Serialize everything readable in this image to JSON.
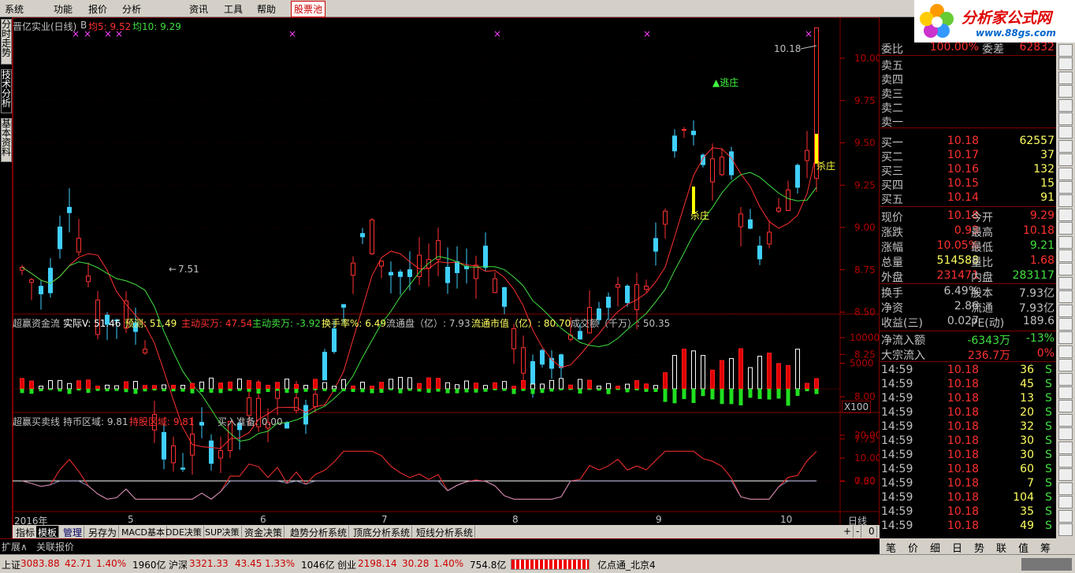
{
  "menu": [
    "系统",
    "功能",
    "报价",
    "分析",
    "资讯",
    "工具",
    "帮助"
  ],
  "menu_hot": "股票池",
  "logo": {
    "title": "分析家公式网",
    "url": "www.88gs.com"
  },
  "left_tabs": [
    "分时走势",
    "技术分析",
    "基本资料"
  ],
  "chart_header": {
    "name": "晋亿实业(日线)",
    "flag": "B",
    "ma5_label": "均5: 9.52",
    "ma10_label": "均10: 9.29"
  },
  "price_axis": [
    "10.00",
    "9.75",
    "9.50",
    "9.25",
    "9.00",
    "8.75",
    "8.50",
    "8.25",
    "8.00",
    "7.75",
    "7.50"
  ],
  "annotations": {
    "high": "10.18",
    "low": "7.51",
    "escape": "逃庄",
    "kill1": "杀庄",
    "kill2": "杀庄"
  },
  "fund_header": {
    "name": "超赢资金流",
    "actual": "实际V: 51.46",
    "predict": "预测: 51.49",
    "buy": "主动买万: 47.54",
    "sell": "主动卖万: -3.92",
    "turnover": "换手率%: 6.49",
    "float": "流通盘（亿）: 7.93",
    "floatval": "流通市值（亿）: 80.70",
    "amount": "成交额（千万）: 50.35"
  },
  "fund_axis": [
    "10000",
    "5000"
  ],
  "fund_unit": "X100",
  "buysell_header": {
    "name": "超赢买卖线",
    "hold_market": "持币区域: 9.81",
    "hold_stock": "持股区域: 9.81",
    "ready": "买入准备: 0.00"
  },
  "bs_axis": [
    "20.00",
    "10.00",
    "0.00"
  ],
  "date_axis": {
    "year": "2016年",
    "months": [
      "5",
      "6",
      "7",
      "8",
      "9",
      "10"
    ],
    "period": "日线"
  },
  "bottom_tabs": [
    "指标",
    "模板",
    "管理",
    "另存为",
    "MACD基本",
    "DDE决策",
    "SUP决策",
    "资金决策",
    "趋势分析系统",
    "顶底分析系统",
    "短线分析系统"
  ],
  "bottom_ctrl": [
    "+",
    "-",
    "0"
  ],
  "bottom_left": [
    "扩展∧",
    "关联报价"
  ],
  "quote": {
    "weibi": "委比",
    "weibi_v": "100.00%",
    "weicha": "委差",
    "weicha_v": "62832",
    "sells": [
      "卖五",
      "卖四",
      "卖三",
      "卖二",
      "卖一"
    ],
    "buys": [
      [
        "买一",
        "10.18",
        "62557"
      ],
      [
        "买二",
        "10.17",
        "37"
      ],
      [
        "买三",
        "10.16",
        "132"
      ],
      [
        "买四",
        "10.15",
        "15"
      ],
      [
        "买五",
        "10.14",
        "91"
      ]
    ],
    "rows": [
      [
        "现价",
        "10.18",
        "今开",
        "9.29"
      ],
      [
        "涨跌",
        "0.93",
        "最高",
        "10.18"
      ],
      [
        "涨幅",
        "10.05%",
        "最低",
        "9.21"
      ],
      [
        "总量",
        "514588",
        "量比",
        "1.68"
      ],
      [
        "外盘",
        "231471",
        "内盘",
        "283117"
      ]
    ],
    "rows2": [
      [
        "换手",
        "6.49%",
        "股本",
        "7.93亿"
      ],
      [
        "净资",
        "2.86",
        "流通",
        "7.93亿"
      ],
      [
        "收益(三)",
        "0.027",
        "PE(动)",
        "189.6"
      ]
    ],
    "net_in": [
      "净流入额",
      "-6343万",
      "-13%"
    ],
    "block_in": [
      "大宗流入",
      "236.7万",
      "0%"
    ],
    "ticks": [
      [
        "14:59",
        "10.18",
        "36",
        "S"
      ],
      [
        "14:59",
        "10.18",
        "45",
        "S"
      ],
      [
        "14:59",
        "10.18",
        "13",
        "S"
      ],
      [
        "14:59",
        "10.18",
        "20",
        "S"
      ],
      [
        "14:59",
        "10.18",
        "32",
        "S"
      ],
      [
        "14:59",
        "10.18",
        "30",
        "S"
      ],
      [
        "14:59",
        "10.18",
        "30",
        "S"
      ],
      [
        "14:59",
        "10.18",
        "60",
        "S"
      ],
      [
        "14:59",
        "10.18",
        "7",
        "S"
      ],
      [
        "14:59",
        "10.18",
        "104",
        "S"
      ],
      [
        "14:59",
        "10.18",
        "35",
        "S"
      ],
      [
        "14:59",
        "10.18",
        "49",
        "S"
      ]
    ]
  },
  "right_tabs": [
    "笔",
    "价",
    "细",
    "日",
    "势",
    "联",
    "值",
    "筹"
  ],
  "status": {
    "sh": "上证",
    "sh_v": "3083.88",
    "sh_c": "42.71",
    "sh_p": "1.40%",
    "sh_a": "1960亿",
    "sz": "沪深",
    "sz_v": "3321.33",
    "sz_c": "43.45",
    "sz_p": "1.33%",
    "sz_a": "1046亿",
    "cy": "创业",
    "cy_v": "2198.14",
    "cy_c": "30.28",
    "cy_p": "1.40%",
    "cy_a": "754.8亿",
    "conn": "亿点通_北京4"
  }
}
